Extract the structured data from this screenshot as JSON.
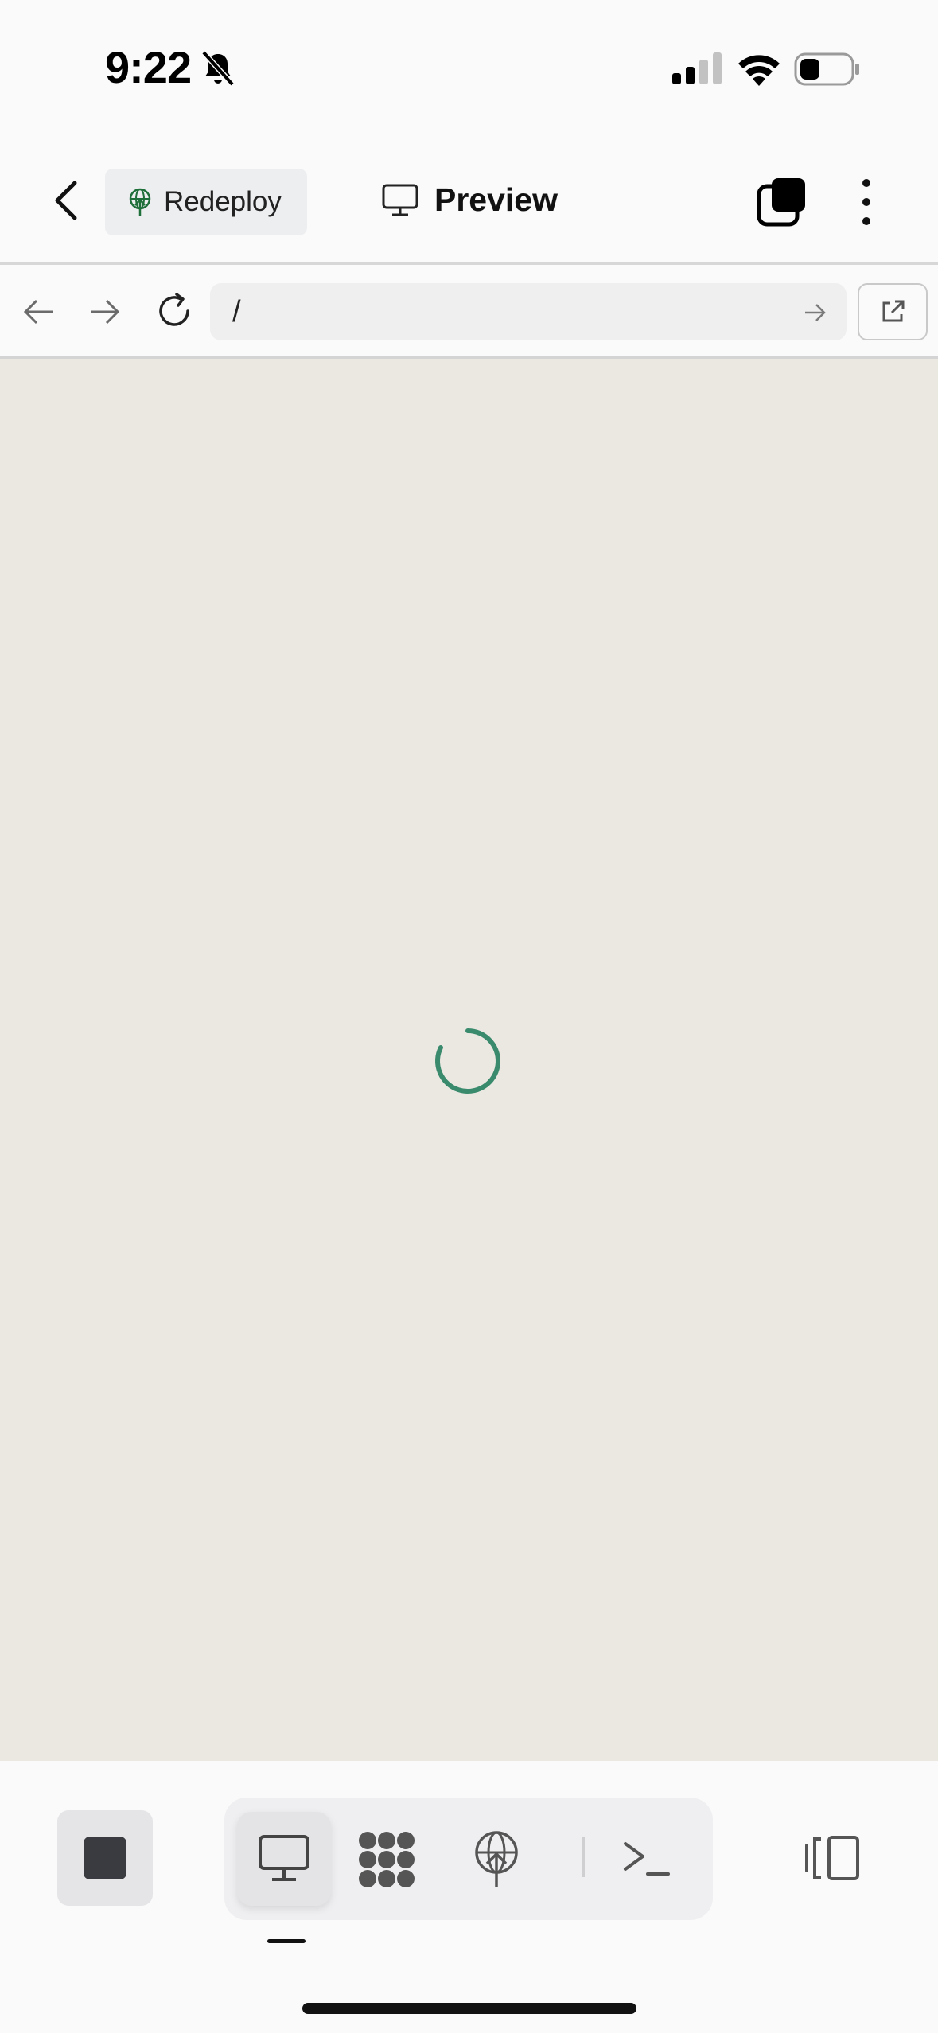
{
  "status_bar": {
    "time": "9:22",
    "icons": [
      "bell-slash-icon",
      "cellular-signal-icon",
      "wifi-icon",
      "battery-icon"
    ]
  },
  "header": {
    "redeploy_label": "Redeploy",
    "preview_label": "Preview",
    "icons": [
      "chevron-left-icon",
      "deploy-globe-icon",
      "monitor-icon",
      "windows-stack-icon",
      "more-vertical-icon"
    ],
    "accent_color": "#1f6f3a"
  },
  "browser": {
    "url": "/",
    "icons": [
      "arrow-left-icon",
      "arrow-right-icon",
      "reload-icon",
      "go-arrow-icon",
      "external-link-icon"
    ]
  },
  "content": {
    "background": "#ebe8e1",
    "state": "loading",
    "spinner_color": "#3a8a6d"
  },
  "toolbar": {
    "icons": [
      "stop-icon",
      "monitor-icon",
      "packages-icon",
      "deploy-globe-icon",
      "terminal-icon",
      "panel-toggle-icon"
    ],
    "active_tool": "monitor-icon"
  }
}
